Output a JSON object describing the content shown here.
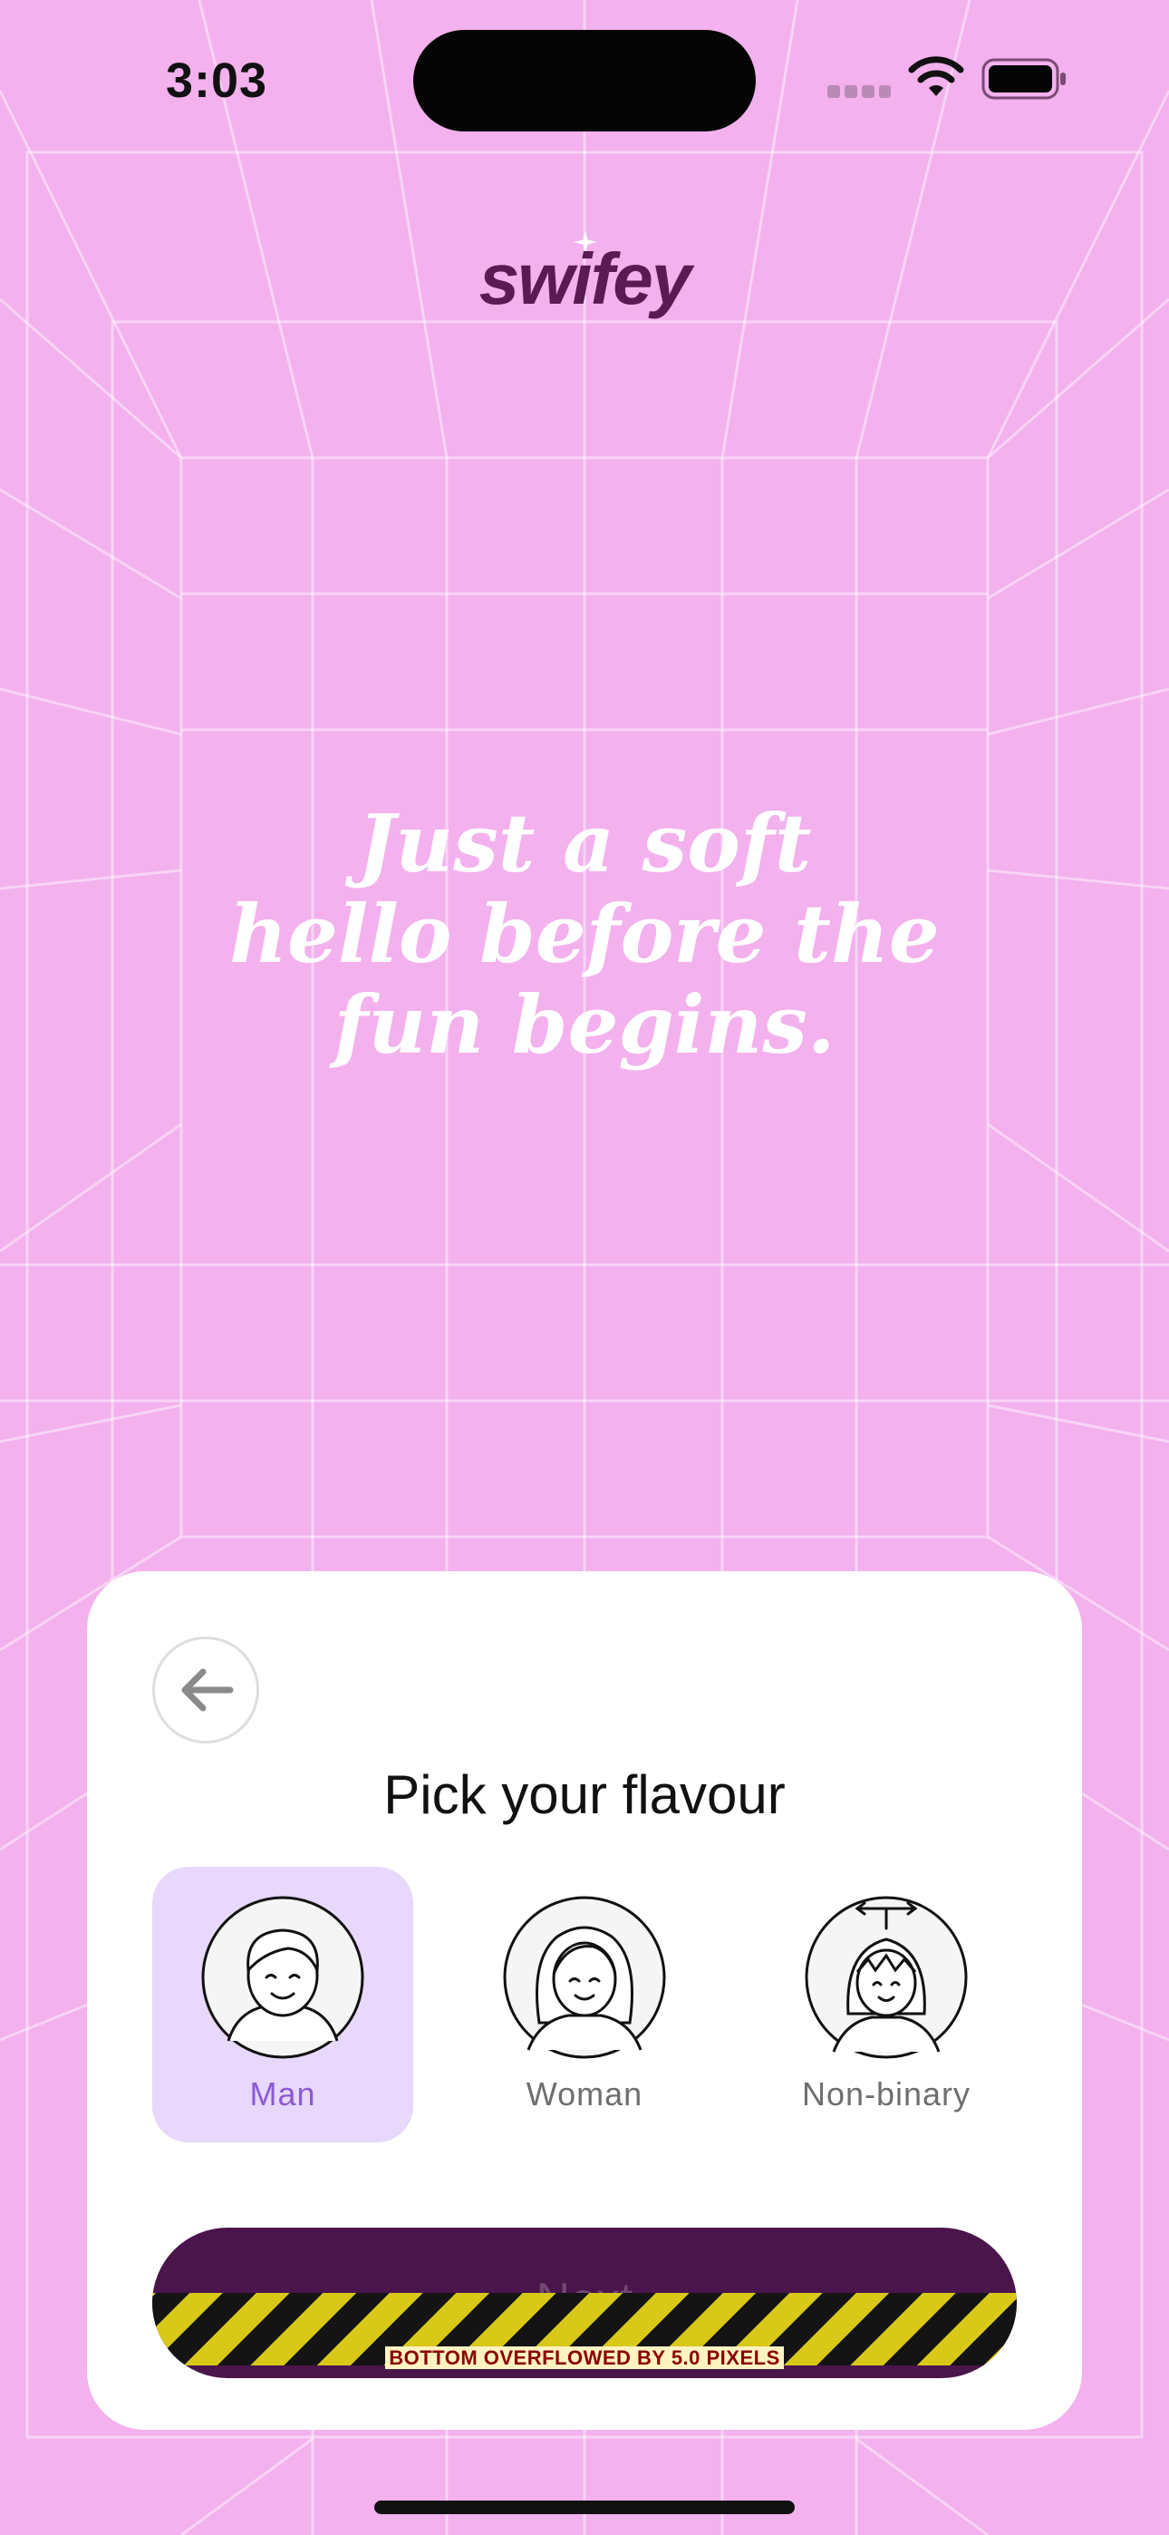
{
  "status_bar": {
    "time": "3:03"
  },
  "app": {
    "logo_text": "swifey",
    "logo_icon": "sparkle-icon"
  },
  "hero": {
    "lines": [
      "Just a soft",
      "hello before the",
      "fun begins."
    ]
  },
  "card": {
    "back_icon": "arrow-left-icon",
    "title": "Pick your flavour",
    "options": [
      {
        "label": "Man",
        "icon": "man-avatar-icon",
        "selected": true
      },
      {
        "label": "Woman",
        "icon": "woman-avatar-icon",
        "selected": false
      },
      {
        "label": "Non-binary",
        "icon": "non-binary-avatar-icon",
        "selected": false
      }
    ],
    "next_label": "Next",
    "overflow_warning": "BOTTOM OVERFLOWED BY 5.0 PIXELS"
  },
  "colors": {
    "background": "#f3b1ee",
    "logo": "#5a1a52",
    "accent_selected": "#e8d8fb",
    "accent_text": "#8a5ad2",
    "button": "#4a154a"
  }
}
